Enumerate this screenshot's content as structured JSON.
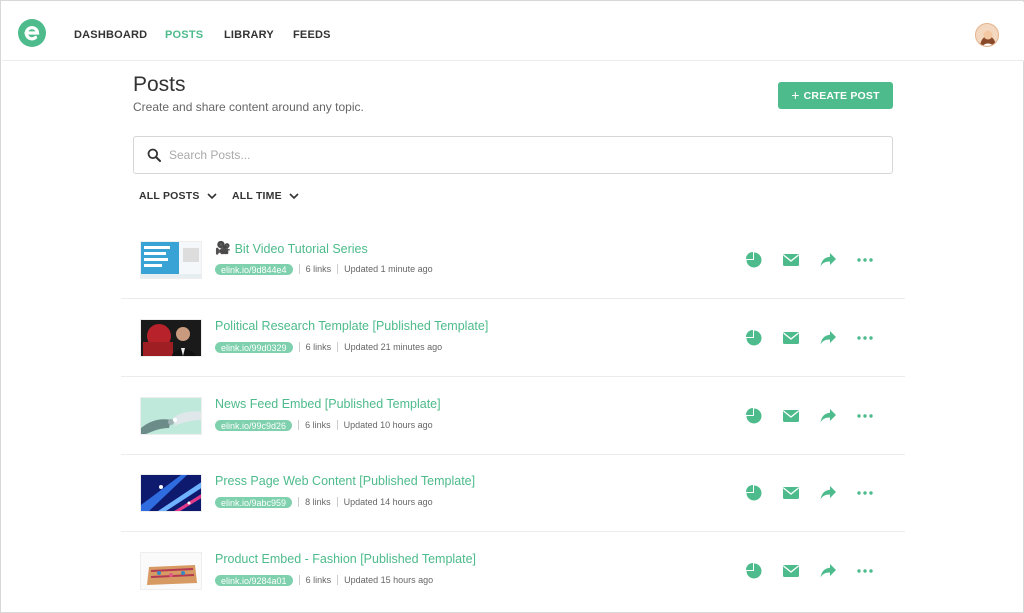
{
  "nav": {
    "items": [
      "DASHBOARD",
      "POSTS",
      "LIBRARY",
      "FEEDS"
    ],
    "active_index": 1
  },
  "header": {
    "title": "Posts",
    "subtitle": "Create and share content around any topic.",
    "create_label": "CREATE POST"
  },
  "search": {
    "placeholder": "Search Posts..."
  },
  "filters": {
    "type_label": "ALL POSTS",
    "time_label": "ALL TIME"
  },
  "colors": {
    "accent": "#4dbb8b",
    "pill": "#7fd0ad"
  },
  "posts": [
    {
      "icon": "🎥",
      "title": "Bit Video Tutorial Series",
      "link": "elink.io/9d844e4",
      "links": "6 links",
      "updated": "Updated 1 minute ago"
    },
    {
      "icon": "",
      "title": "Political Research Template [Published Template]",
      "link": "elink.io/99d0329",
      "links": "6 links",
      "updated": "Updated 21 minutes ago"
    },
    {
      "icon": "",
      "title": "News Feed Embed [Published Template]",
      "link": "elink.io/99c9d26",
      "links": "6 links",
      "updated": "Updated 10 hours ago"
    },
    {
      "icon": "",
      "title": "Press Page Web Content [Published Template]",
      "link": "elink.io/9abc959",
      "links": "8 links",
      "updated": "Updated 14 hours ago"
    },
    {
      "icon": "",
      "title": "Product Embed - Fashion [Published Template]",
      "link": "elink.io/9284a01",
      "links": "6 links",
      "updated": "Updated 15 hours ago"
    }
  ]
}
